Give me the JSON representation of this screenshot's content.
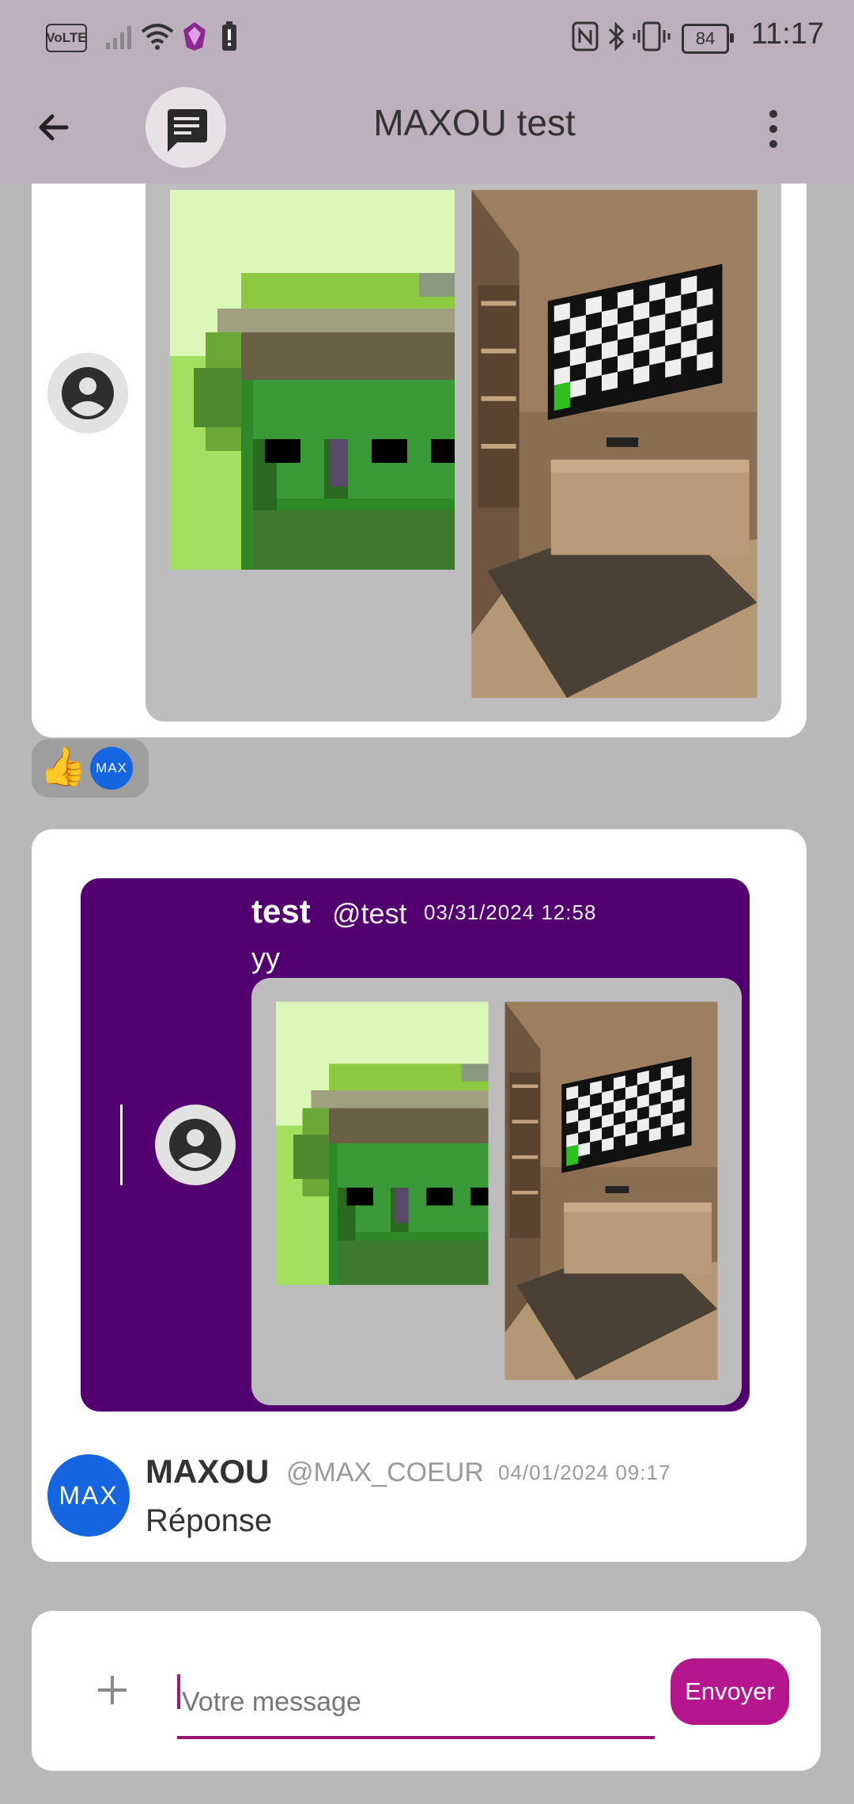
{
  "status_bar": {
    "network_label": "VoLTE",
    "battery": "84",
    "time": "11:17"
  },
  "app_bar": {
    "title": "MAXOU test",
    "icons": [
      "back-arrow-icon",
      "chat-bubble-icon",
      "more-vert-icon"
    ]
  },
  "reactions": {
    "emoji": "👍",
    "user_initials": "MAX"
  },
  "quoted_message": {
    "name": "test",
    "handle": "@test",
    "date": "03/31/2024 12:58",
    "text": "yy"
  },
  "reply_message": {
    "avatar_initials": "MAX",
    "name": "MAXOU",
    "handle": "@MAX_COEUR",
    "date": "04/01/2024 09:17",
    "text": "Réponse"
  },
  "composer": {
    "placeholder": "Votre message",
    "send_label": "Envoyer"
  },
  "colors": {
    "app_bar": "#bcb0bc",
    "background": "#b8b8b8",
    "quote_bg": "#52006f",
    "accent": "#b5168e",
    "avatar_blue": "#1565e0"
  }
}
